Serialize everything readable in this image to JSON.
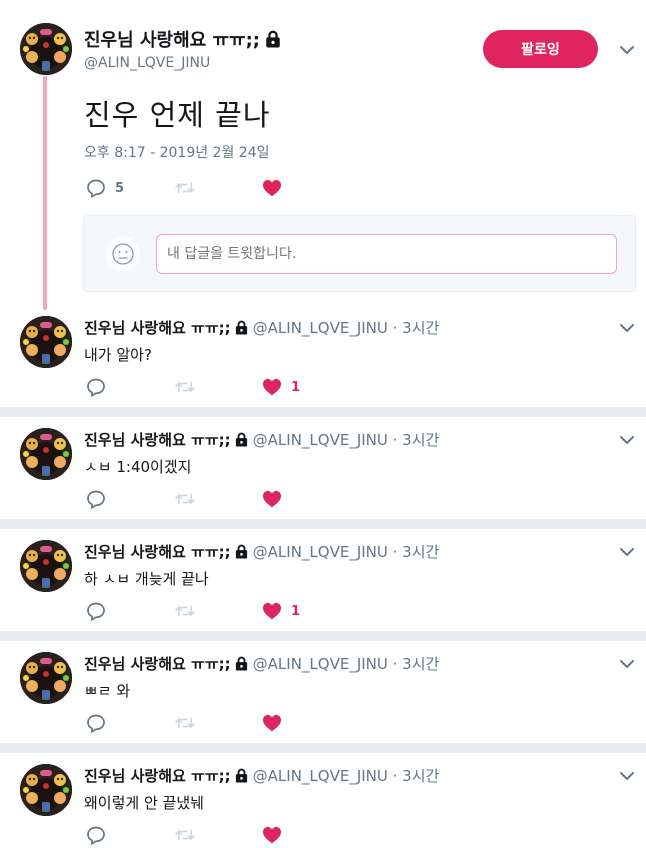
{
  "main": {
    "name": "진우님 사랑해요 ㅠㅠ;;",
    "handle": "@ALIN_LQVE_JINU",
    "follow_label": "팔로잉",
    "text": "진우 언제 끝나",
    "timestamp": "오후 8:17 - 2019년 2월 24일",
    "reply_count": "5",
    "retweet_count": "",
    "like_count": ""
  },
  "reply_box": {
    "placeholder": "내 답글을 트윗합니다."
  },
  "replies": [
    {
      "name": "진우님 사랑해요 ㅠㅠ;;",
      "meta": "@ALIN_LQVE_JINU · 3시간",
      "text": "내가 알아?",
      "reply_count": "",
      "like_count": "1"
    },
    {
      "name": "진우님 사랑해요 ㅠㅠ;;",
      "meta": "@ALIN_LQVE_JINU · 3시간",
      "text": "ㅅㅂ 1:40이겠지",
      "reply_count": "",
      "like_count": ""
    },
    {
      "name": "진우님 사랑해요 ㅠㅠ;;",
      "meta": "@ALIN_LQVE_JINU · 3시간",
      "text": "하 ㅅㅂ 개늦게 끝나",
      "reply_count": "",
      "like_count": "1"
    },
    {
      "name": "진우님 사랑해요 ㅠㅠ;;",
      "meta": "@ALIN_LQVE_JINU · 3시간",
      "text": "ㅃㄹ 와",
      "reply_count": "",
      "like_count": ""
    },
    {
      "name": "진우님 사랑해요 ㅠㅠ;;",
      "meta": "@ALIN_LQVE_JINU · 3시간",
      "text": "왜이렇게 안 끝냈눼",
      "reply_count": "",
      "like_count": ""
    }
  ],
  "icons": {
    "reply": "reply-icon",
    "retweet": "retweet-icon",
    "like": "heart-icon",
    "caret": "chevron-down-icon",
    "lock": "lock-icon"
  },
  "colors": {
    "accent": "#e0245e",
    "thread_line": "#f4a6bf",
    "muted": "#657786",
    "retweet_disabled": "#ccd6dd",
    "separator": "#e6ecf0"
  }
}
